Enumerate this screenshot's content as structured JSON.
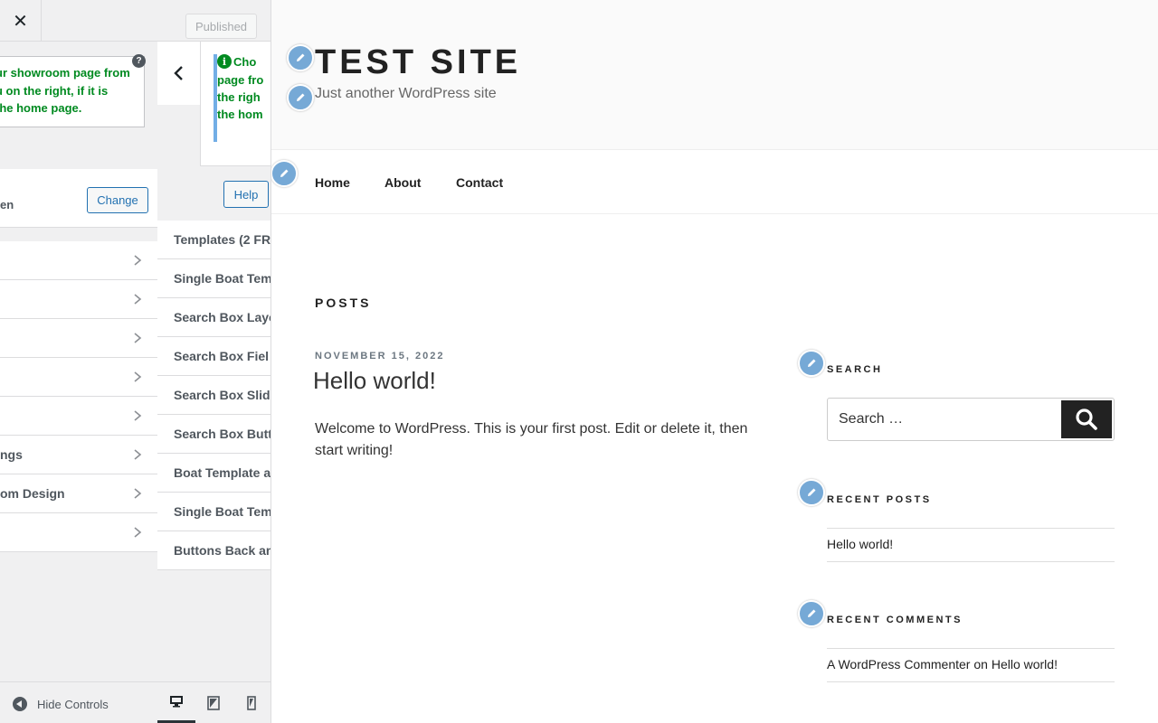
{
  "topbar": {
    "close_symbol": "✕",
    "published_label": "Published"
  },
  "left_panel": {
    "notice_lines": "ur showroom page from\nu on the right, if it is\nthe home page.",
    "help_symbol": "?",
    "change_row_label": "en",
    "change_button": "Change",
    "menu_items": [
      "",
      "",
      "",
      "",
      "",
      "ngs",
      "om Design",
      ""
    ]
  },
  "right_panel": {
    "info_symbol": "i",
    "notice_first": "Cho",
    "notice_rest": "page fro\nthe righ\nthe hom",
    "help_button": "Help",
    "menu_items": [
      "Templates (2 FR",
      "Single Boat Tem",
      "Search Box Layo",
      "Search Box Fiel",
      "Search Box Slid",
      "Search Box Butt",
      "Boat Template a",
      "Single Boat Tem",
      "Buttons Back an"
    ]
  },
  "footer": {
    "hide_controls": "Hide Controls"
  },
  "preview": {
    "site_title": "TEST SITE",
    "site_description": "Just another WordPress site",
    "nav": [
      "Home",
      "About",
      "Contact"
    ],
    "posts_heading": "POSTS",
    "post": {
      "date": "NOVEMBER 15, 2022",
      "title": "Hello world!",
      "excerpt": "Welcome to WordPress. This is your first post. Edit or delete it, then start writing!"
    },
    "widgets": {
      "search_title": "SEARCH",
      "search_placeholder": "Search …",
      "recent_posts_title": "RECENT POSTS",
      "recent_posts": [
        "Hello world!"
      ],
      "recent_comments_title": "RECENT COMMENTS",
      "comment_author": "A WordPress Commenter",
      "comment_on": "on",
      "comment_post": "Hello world!"
    }
  },
  "colors": {
    "accent": "#2271b1",
    "notice_green": "#008a20",
    "pencil_blue": "#76a9d6"
  }
}
